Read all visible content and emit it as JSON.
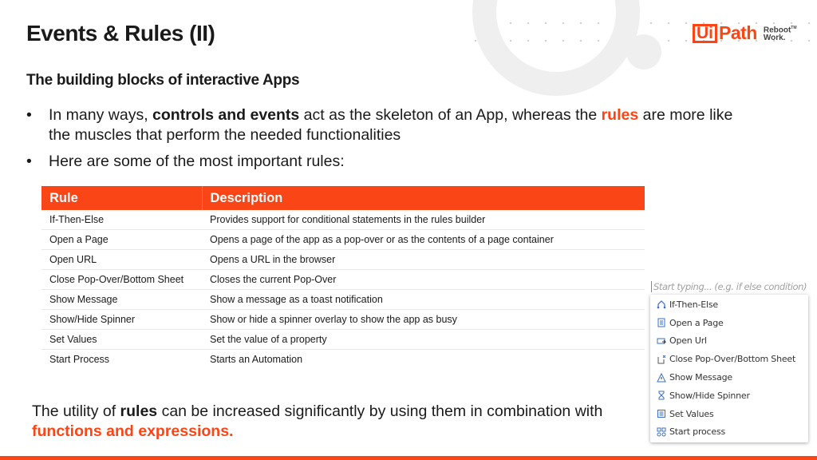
{
  "slide": {
    "title": "Events & Rules (II)",
    "subtitle": "The building blocks of interactive Apps"
  },
  "logo": {
    "brand_ui": "Ui",
    "brand_path": "Path",
    "tagline_line1": "Reboot",
    "tagline_line2": "Work.",
    "trademark": "TM",
    "brand_color": "#fa4616"
  },
  "bullets": [
    {
      "parts": {
        "p1": "In many ways, ",
        "p2_bold": "controls and events",
        "p3": " act as the skeleton of an App, whereas the ",
        "p4_orange": "rules",
        "p5": " are more like the muscles that perform the needed functionalities"
      }
    },
    {
      "text": "Here are some of the most important rules:"
    }
  ],
  "table": {
    "headers": [
      "Rule",
      "Description"
    ],
    "rows": [
      [
        "If-Then-Else",
        "Provides support for conditional statements in the rules builder"
      ],
      [
        "Open a Page",
        "Opens a page of the app as a pop-over or as the contents of a page container"
      ],
      [
        "Open URL",
        "Opens a URL in the browser"
      ],
      [
        "Close Pop-Over/Bottom Sheet",
        "Closes the current Pop-Over"
      ],
      [
        "Show Message",
        "Show a message as a toast notification"
      ],
      [
        "Show/Hide Spinner",
        "Show or hide a spinner overlay to show the app as busy"
      ],
      [
        "Set Values",
        "Set the value of a property"
      ],
      [
        "Start Process",
        "Starts an Automation"
      ]
    ]
  },
  "rule_picker": {
    "placeholder": "Start typing... (e.g. if else condition)",
    "items": [
      {
        "label": "If-Then-Else",
        "icon": "branch-icon"
      },
      {
        "label": "Open a Page",
        "icon": "page-icon"
      },
      {
        "label": "Open Url",
        "icon": "open-url-icon"
      },
      {
        "label": "Close Pop-Over/Bottom Sheet",
        "icon": "close-popover-icon"
      },
      {
        "label": "Show Message",
        "icon": "warning-icon"
      },
      {
        "label": "Show/Hide Spinner",
        "icon": "hourglass-icon"
      },
      {
        "label": "Set Values",
        "icon": "list-icon"
      },
      {
        "label": "Start process",
        "icon": "process-icon"
      }
    ]
  },
  "conclusion": {
    "p1": "The utility of ",
    "p2_bold": "rules",
    "p3": " can be increased significantly by using them in combination with ",
    "p4_orange": "functions and expressions."
  }
}
